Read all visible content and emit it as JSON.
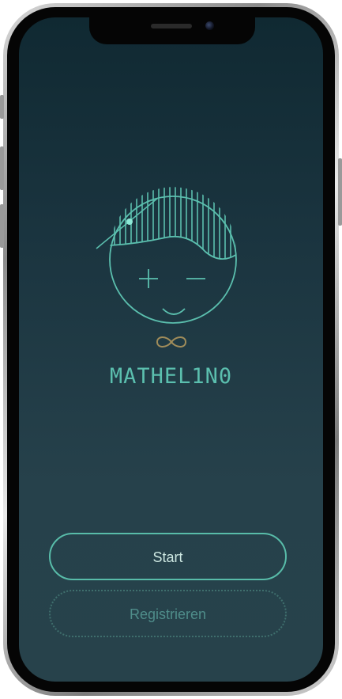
{
  "app": {
    "brand_name": "MATHEL1N0"
  },
  "actions": {
    "start_label": "Start",
    "register_label": "Registrieren"
  },
  "colors": {
    "accent": "#5bbfae",
    "background_top": "#102932",
    "background_bottom": "#27424b",
    "infinity": "#a08c5a"
  },
  "icons": {
    "logo": "smiling-face-logo-icon",
    "infinity": "infinity-icon"
  }
}
